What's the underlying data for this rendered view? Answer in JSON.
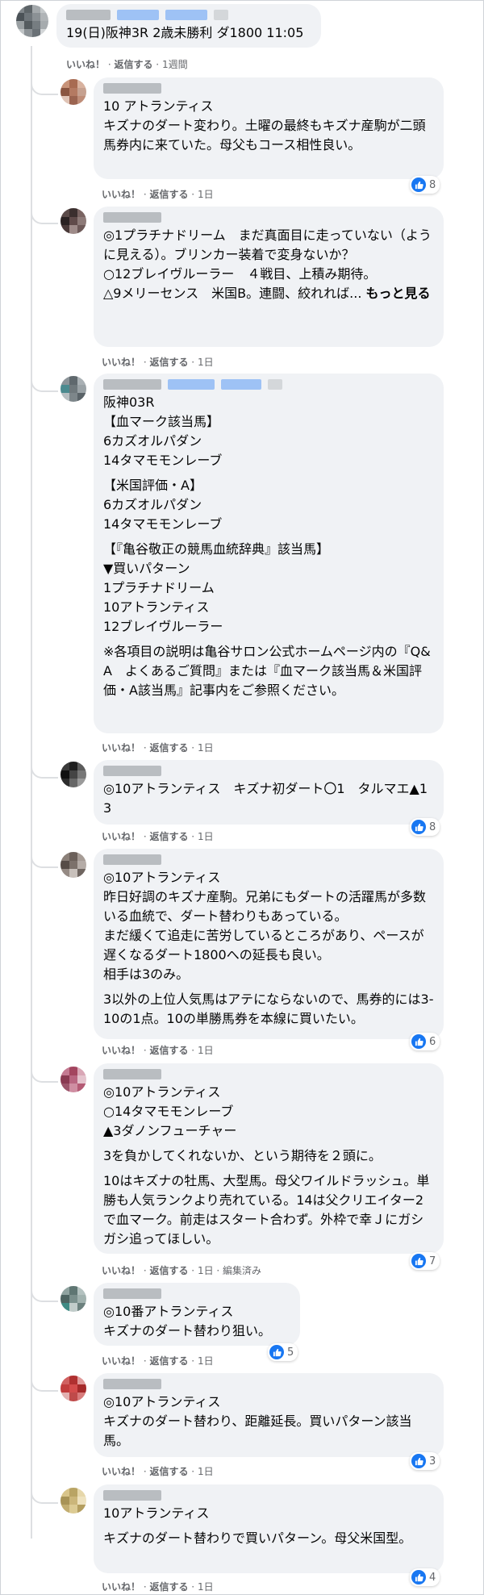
{
  "post": {
    "text": "19(日)阪神3R 2歳未勝利 ダ1800 11:05",
    "actions": {
      "like": "いいね！",
      "reply": "返信する",
      "time": "1週間"
    }
  },
  "comments": [
    {
      "text": "10 アトランティス\nキズナのダート変わり。土曜の最終もキズナ産駒が二頭馬券内に来ていた。母父もコース相性良い。",
      "actions": {
        "like": "いいね！",
        "reply": "返信する",
        "time": "1日"
      },
      "likes": "8"
    },
    {
      "text": "◎1プラチナドリーム　まだ真面目に走っていない（ように見える）。ブリンカー装着で変身ないか？\n○12ブレイヴルーラー　４戦目、上積み期待。\n△9メリーセンス　米国B。連闘、絞れれば... ",
      "more": "もっと見る",
      "actions": {
        "like": "いいね！",
        "reply": "返信する",
        "time": "1日"
      }
    },
    {
      "p1": "阪神03R\n【血マーク該当馬】\n6カズオルパダン\n14タマモモンレーブ",
      "p2": "【米国評価・A】\n6カズオルパダン\n14タマモモンレーブ",
      "p3": "【『亀谷敬正の競馬血統辞典』該当馬】\n▼買いパターン\n1プラチナドリーム\n10アトランティス\n12ブレイヴルーラー",
      "p4": "※各項目の説明は亀谷サロン公式ホームページ内の『Q&A　よくあるご質問』または『血マーク該当馬＆米国評価・A該当馬』記事内をご参照ください。",
      "actions": {
        "like": "いいね！",
        "reply": "返信する",
        "time": "1日"
      }
    },
    {
      "text": "◎10アトランティス　キズナ初ダート〇1　タルマエ▲13",
      "actions": {
        "like": "いいね！",
        "reply": "返信する",
        "time": "1日"
      },
      "likes": "8"
    },
    {
      "p1": "◎10アトランティス\n昨日好調のキズナ産駒。兄弟にもダートの活躍馬が多数いる血統で、ダート替わりもあっている。\nまだ緩くて追走に苦労しているところがあり、ペースが遅くなるダート1800への延長も良い。\n相手は3のみ。",
      "p2": "3以外の上位人気馬はアテにならないので、馬券的には3-10の1点。10の単勝馬券を本線に買いたい。",
      "actions": {
        "like": "いいね！",
        "reply": "返信する",
        "time": "1日"
      },
      "likes": "6"
    },
    {
      "p1": "◎10アトランティス\n○14タマモモンレーブ\n▲3ダノンフューチャー",
      "p2": "3を負かしてくれないか、という期待を２頭に。",
      "p3": "10はキズナの牡馬、大型馬。母父ワイルドラッシュ。単勝も人気ランクより売れている。14は父クリエイター2で血マーク。前走はスタート合わず。外枠で幸Ｊにガシガシ追ってほしい。",
      "actions": {
        "like": "いいね！",
        "reply": "返信する",
        "time": "1日",
        "edited": "編集済み"
      },
      "likes": "7"
    },
    {
      "text": "◎10番アトランティス\nキズナのダート替わり狙い。",
      "actions": {
        "like": "いいね！",
        "reply": "返信する",
        "time": "1日"
      },
      "likes": "5"
    },
    {
      "text": "◎10アトランティス\nキズナのダート替わり、距離延長。買いパターン該当馬。",
      "actions": {
        "like": "いいね！",
        "reply": "返信する",
        "time": "1日"
      },
      "likes": "3"
    },
    {
      "p1": "10アトランティス",
      "p2": "キズナのダート替わりで買いパターン。母父米国型。",
      "actions": {
        "like": "いいね！",
        "reply": "返信する",
        "time": "1日"
      },
      "likes": "4"
    }
  ],
  "colors": {
    "bubble": "#f0f2f5",
    "like_blue": "#1877f2",
    "meta_gray": "#65676b",
    "link_blur": "#9ec2f5"
  },
  "icons": {
    "reaction": "like-thumb-icon",
    "avatar": "pixelated-avatar"
  }
}
